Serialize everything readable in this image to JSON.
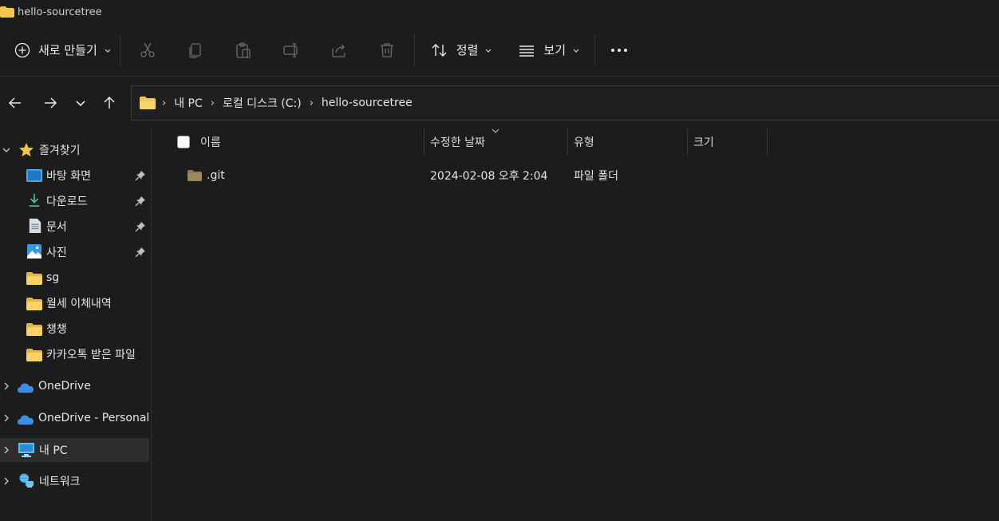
{
  "window": {
    "title": "hello-sourcetree"
  },
  "toolbar": {
    "new_label": "새로 만들기",
    "sort_label": "정렬",
    "view_label": "보기",
    "icons": [
      "cut-icon",
      "copy-icon",
      "paste-icon",
      "rename-icon",
      "share-icon",
      "delete-icon",
      "more-icon"
    ]
  },
  "address": {
    "crumbs": [
      "내 PC",
      "로컬 디스크 (C:)",
      "hello-sourcetree"
    ]
  },
  "sidebar": {
    "quick_access": "즐겨찾기",
    "items": [
      {
        "label": "바탕 화면",
        "icon": "desktop-icon",
        "pinned": true
      },
      {
        "label": "다운로드",
        "icon": "download-icon",
        "pinned": true
      },
      {
        "label": "문서",
        "icon": "document-icon",
        "pinned": true
      },
      {
        "label": "사진",
        "icon": "pictures-icon",
        "pinned": true
      },
      {
        "label": "sg",
        "icon": "folder-icon",
        "pinned": false
      },
      {
        "label": "월세 이체내역",
        "icon": "folder-icon",
        "pinned": false
      },
      {
        "label": "챙챙",
        "icon": "folder-icon",
        "pinned": false
      },
      {
        "label": "카카오톡 받은 파일",
        "icon": "folder-icon",
        "pinned": false
      }
    ],
    "roots": [
      {
        "label": "OneDrive",
        "icon": "onedrive-icon"
      },
      {
        "label": "OneDrive - Personal",
        "icon": "onedrive-icon"
      },
      {
        "label": "내 PC",
        "icon": "pc-icon",
        "selected": true
      },
      {
        "label": "네트워크",
        "icon": "network-icon"
      }
    ]
  },
  "columns": {
    "name": "이름",
    "modified": "수정한 날짜",
    "type": "유형",
    "size": "크기"
  },
  "files": [
    {
      "name": ".git",
      "modified": "2024-02-08 오후 2:04",
      "type": "파일 폴더",
      "size": ""
    }
  ],
  "colors": {
    "background": "#1c1c1c",
    "folder": "#f4c74a",
    "onedrive": "#3d8ee6",
    "accent": "#4cc2ff"
  }
}
